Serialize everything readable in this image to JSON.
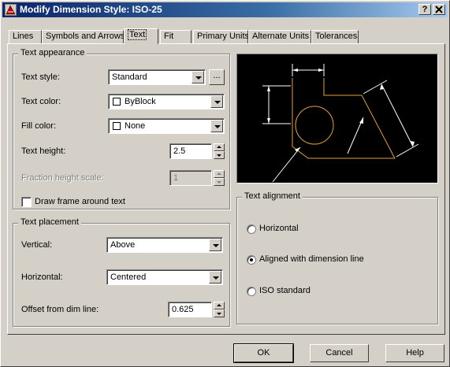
{
  "window": {
    "title": "Modify Dimension Style: ISO-25",
    "help_button": "?",
    "close_button": "X"
  },
  "tabs": [
    {
      "label": "Lines",
      "active": false
    },
    {
      "label": "Symbols and Arrows",
      "active": false
    },
    {
      "label": "Text",
      "active": true
    },
    {
      "label": "Fit",
      "active": false
    },
    {
      "label": "Primary Units",
      "active": false
    },
    {
      "label": "Alternate Units",
      "active": false
    },
    {
      "label": "Tolerances",
      "active": false
    }
  ],
  "text_appearance": {
    "title": "Text appearance",
    "text_style": {
      "label": "Text style:",
      "value": "Standard",
      "browse_label": "..."
    },
    "text_color": {
      "label": "Text color:",
      "value": "ByBlock",
      "swatch": "#ffffff"
    },
    "fill_color": {
      "label": "Fill color:",
      "value": "None",
      "swatch": "#ffffff"
    },
    "text_height": {
      "label": "Text height:",
      "value": "2.5"
    },
    "fraction_height_scale": {
      "label": "Fraction height scale:",
      "value": "1",
      "enabled": false
    },
    "draw_frame": {
      "label": "Draw frame around text",
      "checked": false
    }
  },
  "text_placement": {
    "title": "Text placement",
    "vertical": {
      "label": "Vertical:",
      "value": "Above"
    },
    "horizontal": {
      "label": "Horizontal:",
      "value": "Centered"
    },
    "offset": {
      "label": "Offset from dim line:",
      "value": "0.625"
    }
  },
  "text_alignment": {
    "title": "Text alignment",
    "options": [
      {
        "label": "Horizontal",
        "checked": false
      },
      {
        "label": "Aligned with dimension line",
        "checked": true
      },
      {
        "label": "ISO standard",
        "checked": false
      }
    ]
  },
  "preview": {
    "background": "#000000",
    "dimension_color": "#ffffff",
    "geometry_color": "#e0a040"
  },
  "buttons": {
    "ok": "OK",
    "cancel": "Cancel",
    "help": "Help"
  }
}
